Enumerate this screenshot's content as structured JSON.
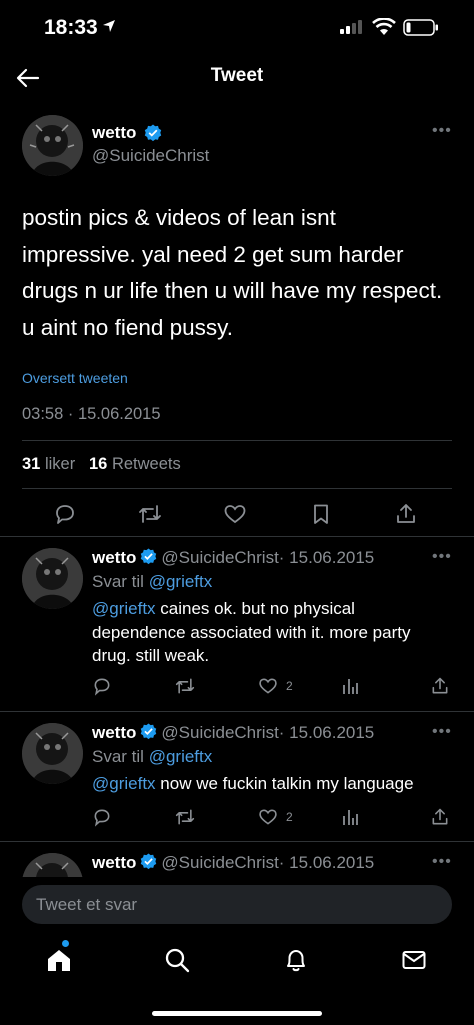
{
  "status_bar": {
    "time": "18:33"
  },
  "header": {
    "title": "Tweet"
  },
  "main_tweet": {
    "name": "wetto",
    "handle": "@SuicideChrist",
    "text": "postin pics & videos of lean isnt impressive. yal need 2 get sum harder drugs n ur life then u will have my respect. u aint no fiend pussy.",
    "translate_label": "Oversett tweeten",
    "timestamp": "03:58 · 15.06.2015",
    "likes_count": "31",
    "likes_label": "liker",
    "retweets_count": "16",
    "retweets_label": "Retweets"
  },
  "replies": [
    {
      "name": "wetto",
      "handle": "@SuicideChrist",
      "date": "· 15.06.2015",
      "reply_to_label": "Svar til",
      "reply_to_handle": "@grieftx",
      "mention": "@grieftx",
      "text": " caines ok. but no physical dependence associated with it. more party drug. still weak.",
      "likes": "2"
    },
    {
      "name": "wetto",
      "handle": "@SuicideChrist",
      "date": "· 15.06.2015",
      "reply_to_label": "Svar til",
      "reply_to_handle": "@grieftx",
      "mention": "@grieftx",
      "text": " now we fuckin talkin my language",
      "likes": "2"
    },
    {
      "name": "wetto",
      "handle": "@SuicideChrist",
      "date": "· 15.06.2015"
    }
  ],
  "composer": {
    "placeholder": "Tweet et svar"
  },
  "colors": {
    "accent": "#1d9bf0",
    "link": "#4d9de0",
    "muted": "#8b8f94",
    "background": "#000000"
  },
  "icons": [
    "back-arrow-icon",
    "verified-icon",
    "more-icon",
    "reply-icon",
    "retweet-icon",
    "like-icon",
    "bookmark-icon",
    "share-icon",
    "analytics-icon",
    "home-icon",
    "search-icon",
    "notifications-icon",
    "messages-icon"
  ]
}
